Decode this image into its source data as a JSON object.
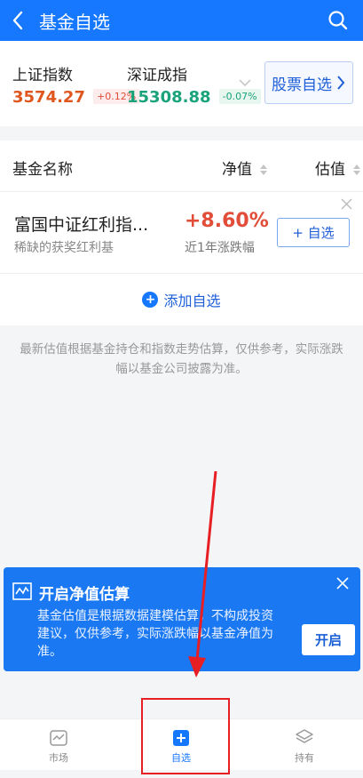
{
  "header": {
    "title": "基金自选",
    "back_icon": "back-arrow-icon",
    "search_icon": "search-icon"
  },
  "indices": [
    {
      "name": "上证指数",
      "value": "3574.27",
      "change": "+0.12%",
      "trend": "up"
    },
    {
      "name": "深证成指",
      "value": "15308.88",
      "change": "-0.07%",
      "trend": "down"
    }
  ],
  "stock_watchlist_button": "股票自选",
  "table_header": {
    "name": "基金名称",
    "nav": "净值",
    "estimate": "估值"
  },
  "funds": [
    {
      "name": "富国中证红利指...",
      "tagline": "稀缺的获奖红利基",
      "return_pct": "+8.60%",
      "return_label": "近1年涨跌幅",
      "action": "+ 自选"
    }
  ],
  "add_watchlist_label": "添加自选",
  "disclaimer": "最新估值根据基金持仓和指数走势估算，仅供参考，实际涨跌幅以基金公司披露为准。",
  "promo": {
    "title": "开启净值估算",
    "text": "基金估值是根据数据建模估算，不构成投资建议，仅供参考，实际涨跌幅以基金净值为准。",
    "button": "开启"
  },
  "bottom_nav": [
    {
      "label": "市场",
      "icon": "market-icon",
      "active": false
    },
    {
      "label": "自选",
      "icon": "watchlist-plus-icon",
      "active": true
    },
    {
      "label": "持有",
      "icon": "holdings-layers-icon",
      "active": false
    }
  ],
  "colors": {
    "primary": "#1677ff",
    "up": "#e24d3a",
    "down": "#1aa37a",
    "annotation": "#e81e25"
  }
}
